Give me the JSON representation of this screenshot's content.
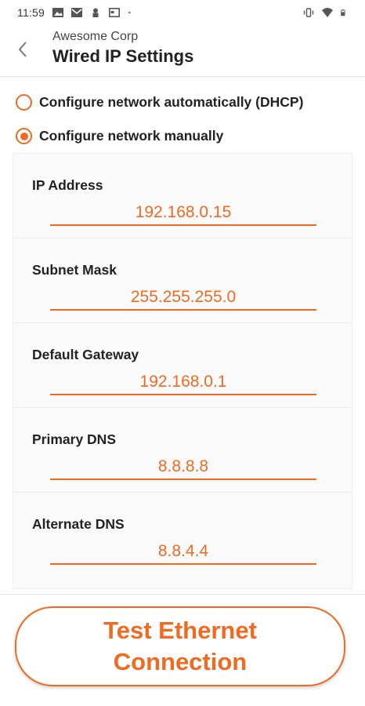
{
  "status_bar": {
    "time": "11:59",
    "left_icons": [
      "image-icon",
      "gmail-icon",
      "profile-icon",
      "calendar-icon",
      "dot-icon"
    ],
    "right_icons": [
      "vibrate-icon",
      "wifi-icon",
      "battery-icon"
    ]
  },
  "header": {
    "subtitle": "Awesome Corp",
    "title": "Wired IP Settings",
    "back_icon": "chevron-left-icon"
  },
  "options": {
    "dhcp_label": "Configure network automatically (DHCP)",
    "dhcp_checked": false,
    "manual_label": "Configure network manually",
    "manual_checked": true
  },
  "fields": [
    {
      "label": "IP Address",
      "value": "192.168.0.15"
    },
    {
      "label": "Subnet Mask",
      "value": "255.255.255.0"
    },
    {
      "label": "Default Gateway",
      "value": "192.168.0.1"
    },
    {
      "label": "Primary DNS",
      "value": "8.8.8.8"
    },
    {
      "label": "Alternate DNS",
      "value": "8.8.4.4"
    }
  ],
  "test_button": {
    "label": "Test Ethernet Connection"
  },
  "colors": {
    "accent": "#f26a21",
    "panel_bg": "#fafafa",
    "text": "#222222"
  }
}
